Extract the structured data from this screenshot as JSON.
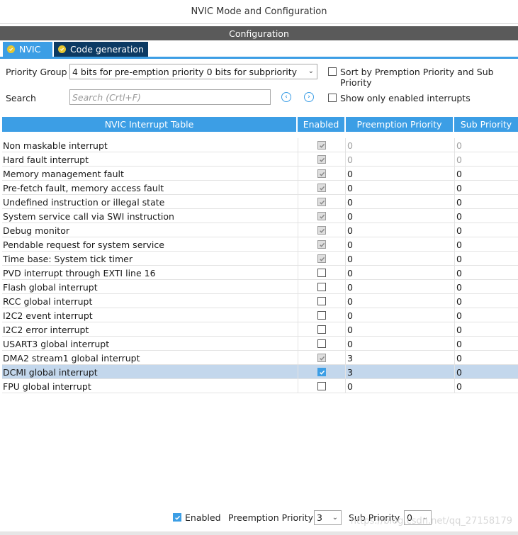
{
  "window": {
    "title": "NVIC Mode and Configuration"
  },
  "config_bar": {
    "label": "Configuration"
  },
  "tabs": [
    {
      "label": "NVIC",
      "active": true
    },
    {
      "label": "Code generation",
      "active": false
    }
  ],
  "priority_group": {
    "label": "Priority Group",
    "value": "4 bits for pre-emption priority 0 bits for subpriority"
  },
  "sort_option": {
    "label": "Sort by Premption Priority and Sub Priority",
    "checked": false
  },
  "search": {
    "label": "Search",
    "placeholder": "Search (Crtl+F)"
  },
  "show_enabled_option": {
    "label": "Show only enabled interrupts",
    "checked": false
  },
  "table": {
    "headers": [
      "NVIC Interrupt Table",
      "Enabled",
      "Preemption Priority",
      "Sub Priority"
    ],
    "rows": [
      {
        "name": "Non maskable interrupt",
        "enabled": "locked",
        "preemption": "0",
        "sub": "0",
        "dim": true
      },
      {
        "name": "Hard fault interrupt",
        "enabled": "locked",
        "preemption": "0",
        "sub": "0",
        "dim": true
      },
      {
        "name": "Memory management fault",
        "enabled": "locked",
        "preemption": "0",
        "sub": "0"
      },
      {
        "name": "Pre-fetch fault, memory access fault",
        "enabled": "locked",
        "preemption": "0",
        "sub": "0"
      },
      {
        "name": "Undefined instruction or illegal state",
        "enabled": "locked",
        "preemption": "0",
        "sub": "0"
      },
      {
        "name": "System service call via SWI instruction",
        "enabled": "locked",
        "preemption": "0",
        "sub": "0"
      },
      {
        "name": "Debug monitor",
        "enabled": "locked",
        "preemption": "0",
        "sub": "0"
      },
      {
        "name": "Pendable request for system service",
        "enabled": "locked",
        "preemption": "0",
        "sub": "0"
      },
      {
        "name": "Time base: System tick timer",
        "enabled": "locked",
        "preemption": "0",
        "sub": "0"
      },
      {
        "name": "PVD interrupt through EXTI line 16",
        "enabled": "off",
        "preemption": "0",
        "sub": "0"
      },
      {
        "name": "Flash global interrupt",
        "enabled": "off",
        "preemption": "0",
        "sub": "0"
      },
      {
        "name": "RCC global interrupt",
        "enabled": "off",
        "preemption": "0",
        "sub": "0"
      },
      {
        "name": "I2C2 event interrupt",
        "enabled": "off",
        "preemption": "0",
        "sub": "0"
      },
      {
        "name": "I2C2 error interrupt",
        "enabled": "off",
        "preemption": "0",
        "sub": "0"
      },
      {
        "name": "USART3 global interrupt",
        "enabled": "off",
        "preemption": "0",
        "sub": "0"
      },
      {
        "name": "DMA2 stream1 global interrupt",
        "enabled": "locked",
        "preemption": "3",
        "sub": "0"
      },
      {
        "name": "DCMI global interrupt",
        "enabled": "on",
        "preemption": "3",
        "sub": "0",
        "selected": true
      },
      {
        "name": "FPU global interrupt",
        "enabled": "off",
        "preemption": "0",
        "sub": "0"
      }
    ]
  },
  "bottom": {
    "enabled_label": "Enabled",
    "enabled_checked": true,
    "preemption_label": "Preemption Priority",
    "preemption_value": "3",
    "sub_label": "Sub Priority",
    "sub_value": "0"
  },
  "watermark": "https://blog.csdn.net/qq_27158179",
  "colors": {
    "accent": "#3c9ee5",
    "tab_dark": "#0c3a63",
    "config_bar": "#5a5a5a",
    "selected_row": "#c3d7ec"
  }
}
